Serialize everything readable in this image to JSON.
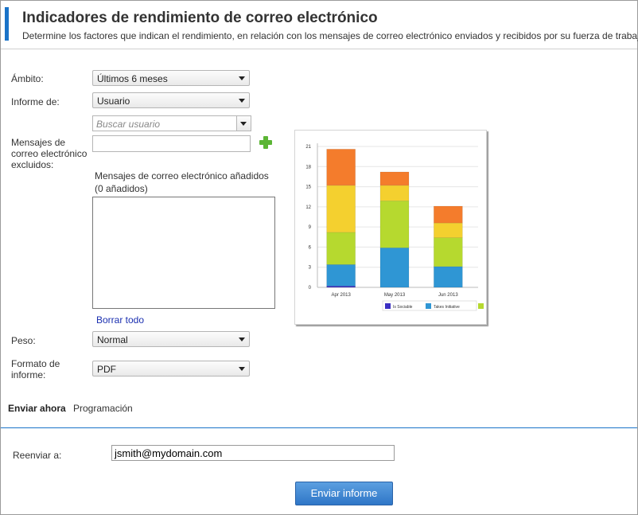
{
  "header": {
    "title": "Indicadores de rendimiento de correo electrónico",
    "subtitle": "Determine los factores que indican el rendimiento, en relación con los mensajes de correo electrónico enviados y recibidos por su fuerza de trabajo"
  },
  "form": {
    "scope_label": "Ámbito:",
    "scope_value": "Últimos 6 meses",
    "report_of_label": "Informe de:",
    "report_of_value": "Usuario",
    "search_user_placeholder": "Buscar usuario",
    "excluded_label_line1": "Mensajes de",
    "excluded_label_line2": "correo electrónico",
    "excluded_label_line3": "excluidos:",
    "excluded_input_value": "",
    "added_caption_line1": "Mensajes de correo electrónico añadidos",
    "added_caption_line2": "(0 añadidos)",
    "clear_all_link": "Borrar todo",
    "weight_label": "Peso:",
    "weight_value": "Normal",
    "format_label_line1": "Formato de",
    "format_label_line2": "informe:",
    "format_value": "PDF"
  },
  "icons": {
    "add": "plus-icon",
    "dropdown": "chevron-down-icon"
  },
  "tabs": {
    "send_now": "Enviar ahora",
    "schedule": "Programación"
  },
  "send": {
    "forward_label": "Reenviar a:",
    "email_value": "jsmith@mydomain.com",
    "send_button": "Enviar informe"
  },
  "colors": {
    "accent": "#1a73c8",
    "link": "#1a2fb0",
    "add_icon": "#5bb534"
  },
  "chart_data": {
    "type": "bar",
    "stacked": true,
    "categories": [
      "Apr 2013",
      "May 2013",
      "Jun 2013"
    ],
    "ylim": [
      0,
      21
    ],
    "yticks": [
      0,
      3,
      6,
      9,
      12,
      15,
      18,
      21
    ],
    "legend_position": "bottom-right",
    "series": [
      {
        "name": "Is Sociable",
        "color": "#3b2fc2",
        "values": [
          0.2,
          0,
          0
        ]
      },
      {
        "name": "Takes Initiative",
        "color": "#2f96d4",
        "values": [
          3.2,
          5.9,
          3.1
        ]
      },
      {
        "name": "",
        "color": "#b6d92f",
        "values": [
          4.8,
          7.0,
          4.3
        ]
      },
      {
        "name": "",
        "color": "#f4d02f",
        "values": [
          7.0,
          2.3,
          2.2
        ]
      },
      {
        "name": "",
        "color": "#f47c2c",
        "values": [
          5.4,
          2.0,
          2.5
        ]
      }
    ]
  }
}
